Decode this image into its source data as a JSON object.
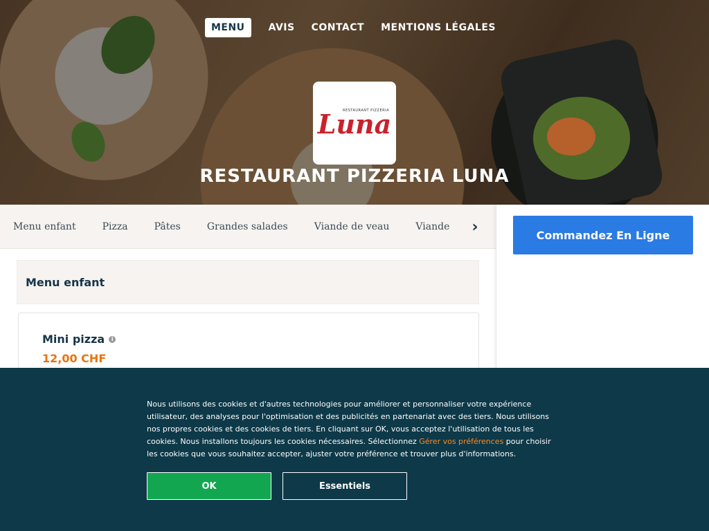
{
  "nav": {
    "items": [
      "MENU",
      "AVIS",
      "CONTACT",
      "MENTIONS LÉGALES"
    ]
  },
  "logo": {
    "small_text": "RESTAURANT PIZZERIA",
    "text": "Luna"
  },
  "hero": {
    "title": "RESTAURANT PIZZERIA LUNA"
  },
  "categories": [
    "Menu enfant",
    "Pizza",
    "Pâtes",
    "Grandes salades",
    "Viande de veau",
    "Viande de bœuf"
  ],
  "section": {
    "title": "Menu enfant",
    "item_name": "Mini pizza",
    "item_price": "12,00 CHF"
  },
  "side": {
    "order_label": "Commandez En Ligne"
  },
  "cookie": {
    "text_before": "Nous utilisons des cookies et d'autres technologies pour améliorer et personnaliser votre expérience utilisateur, des analyses pour l'optimisation et des publicités en partenariat avec des tiers. Nous utilisons nos propres cookies et des cookies de tiers. En cliquant sur OK, vous acceptez l'utilisation de tous les cookies. Nous installons toujours les cookies nécessaires. Sélectionnez ",
    "link": "Gérer vos préférences",
    "text_after": " pour choisir les cookies que vous souhaitez accepter, ajuster votre préférence et trouver plus d'informations.",
    "ok_label": "OK",
    "essential_label": "Essentiels"
  },
  "colors": {
    "brand_red": "#c8222c",
    "order_blue": "#2a7be4",
    "price_orange": "#e8740f",
    "cookie_bg": "#0e3949",
    "ok_green": "#12a651"
  }
}
